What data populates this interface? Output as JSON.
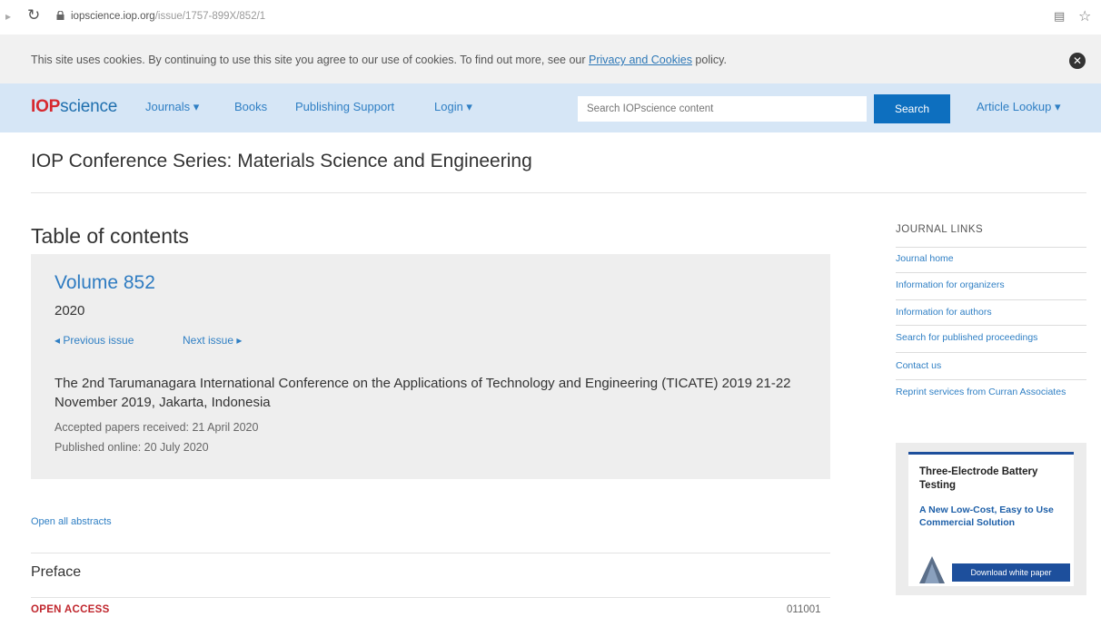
{
  "browser": {
    "url_host": "iopscience.iop.org",
    "url_path": "/issue/1757-899X/852/1"
  },
  "cookie_banner": {
    "text_before": "This site uses cookies. By continuing to use this site you agree to our use of cookies. To find out more, see our ",
    "link": "Privacy and Cookies",
    "text_after": " policy.",
    "close": "✕"
  },
  "navbar": {
    "logo_iop": "IOP",
    "logo_science": "science",
    "items": [
      "Journals ▾",
      "Books",
      "Publishing Support",
      "Login ▾"
    ],
    "search_placeholder": "Search IOPscience content",
    "search_button": "Search",
    "article_lookup": "Article Lookup ▾"
  },
  "journal_title": "IOP Conference Series: Materials Science and Engineering",
  "toc": {
    "heading": "Table of contents",
    "volume": "Volume 852",
    "year": "2020",
    "prev_issue": "◂ Previous issue",
    "next_issue": "Next issue ▸",
    "conference": "The 2nd Tarumanagara International Conference on the Applications of Technology and Engineering (TICATE) 2019 21-22 November 2019, Jakarta, Indonesia",
    "accepted": "Accepted papers received: 21 April 2020",
    "published": "Published online: 20 July 2020",
    "open_all_abstracts": "Open all abstracts",
    "section": "Preface",
    "open_access": "OPEN ACCESS",
    "article_number": "011001"
  },
  "sidebar": {
    "heading": "JOURNAL LINKS",
    "links": [
      "Journal home",
      "Information for organizers",
      "Information for authors",
      "Search for published proceedings",
      "Contact us",
      "Reprint services from Curran Associates"
    ]
  },
  "ad": {
    "headline": "Three-Electrode Battery Testing",
    "subheadline": "A New Low-Cost, Easy to Use Commercial Solution",
    "button": "Download white paper"
  },
  "colors": {
    "navbar_bg": "#d6e6f6",
    "link": "#2f7fc4",
    "search_button": "#0d6fbf",
    "open_access": "#c0262d"
  }
}
